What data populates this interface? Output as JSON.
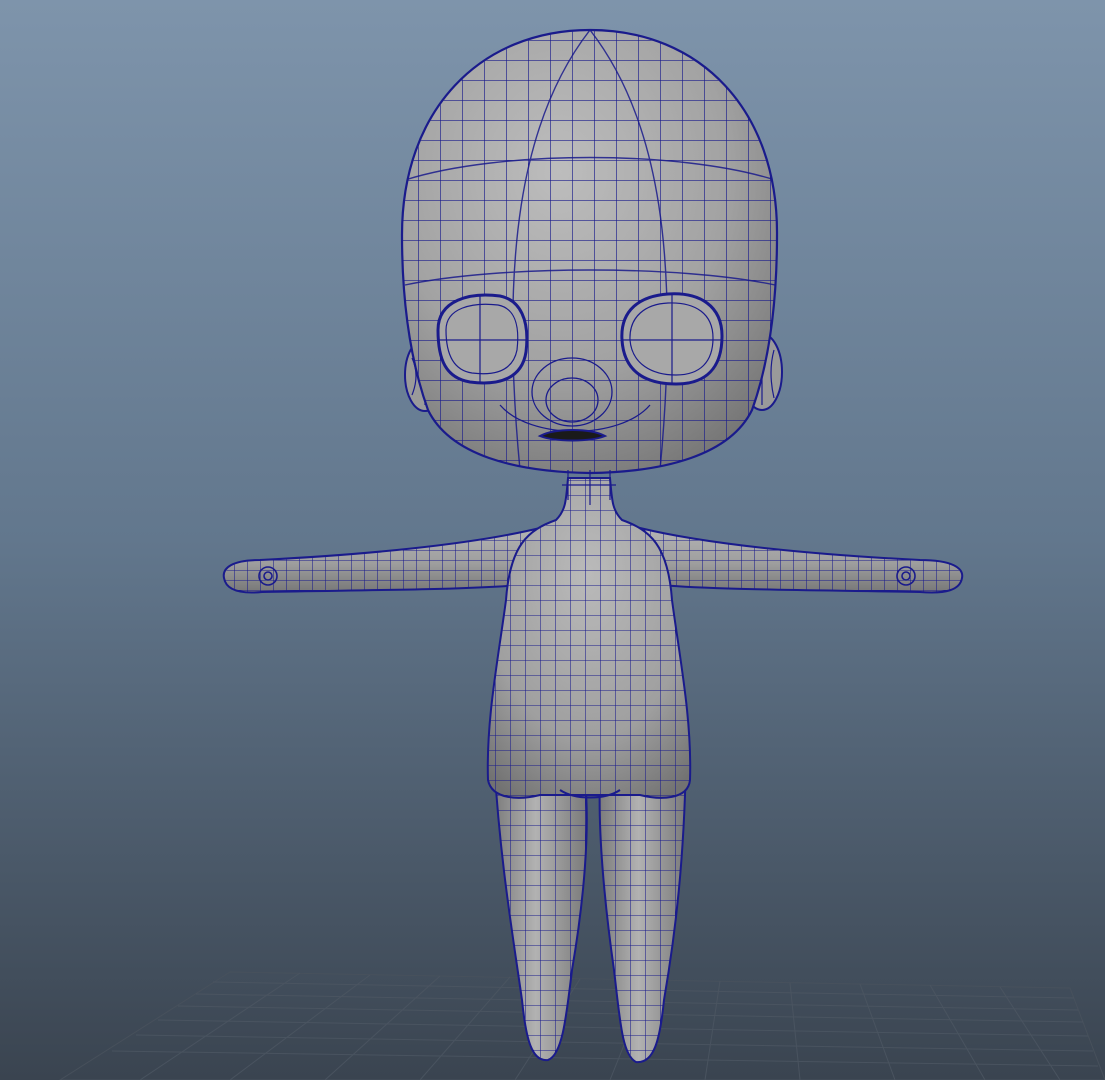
{
  "viewport": {
    "background_top": "#7e94ab",
    "background_mid": "#62778d",
    "background_bottom": "#3a4450",
    "grid_color": "#4a5460"
  },
  "model": {
    "surface_color": "#9b9b9b",
    "surface_highlight": "#b6b6b6",
    "surface_shadow": "#6f6f6f",
    "wire_color": "#1a1b8c",
    "mouth_color": "#121212"
  }
}
